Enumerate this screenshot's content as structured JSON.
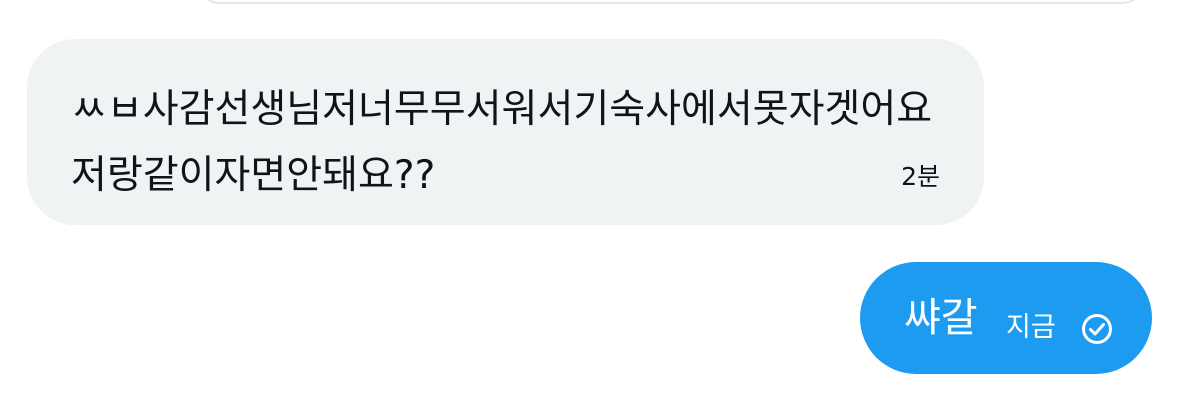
{
  "conversation": {
    "incoming_message": {
      "text": "ㅆㅂ사감선생님저너무무서워서기숙사에서못자겟어요저랑같이자면안돼요??",
      "time": "2분"
    },
    "outgoing_message": {
      "text": "쌰갈",
      "time": "지금",
      "status_icon": "check-circle-icon"
    }
  },
  "colors": {
    "incoming_bubble": "#eff3f4",
    "outgoing_bubble": "#1d9bf0",
    "text_dark": "#0f1419",
    "text_light": "#ffffff"
  }
}
